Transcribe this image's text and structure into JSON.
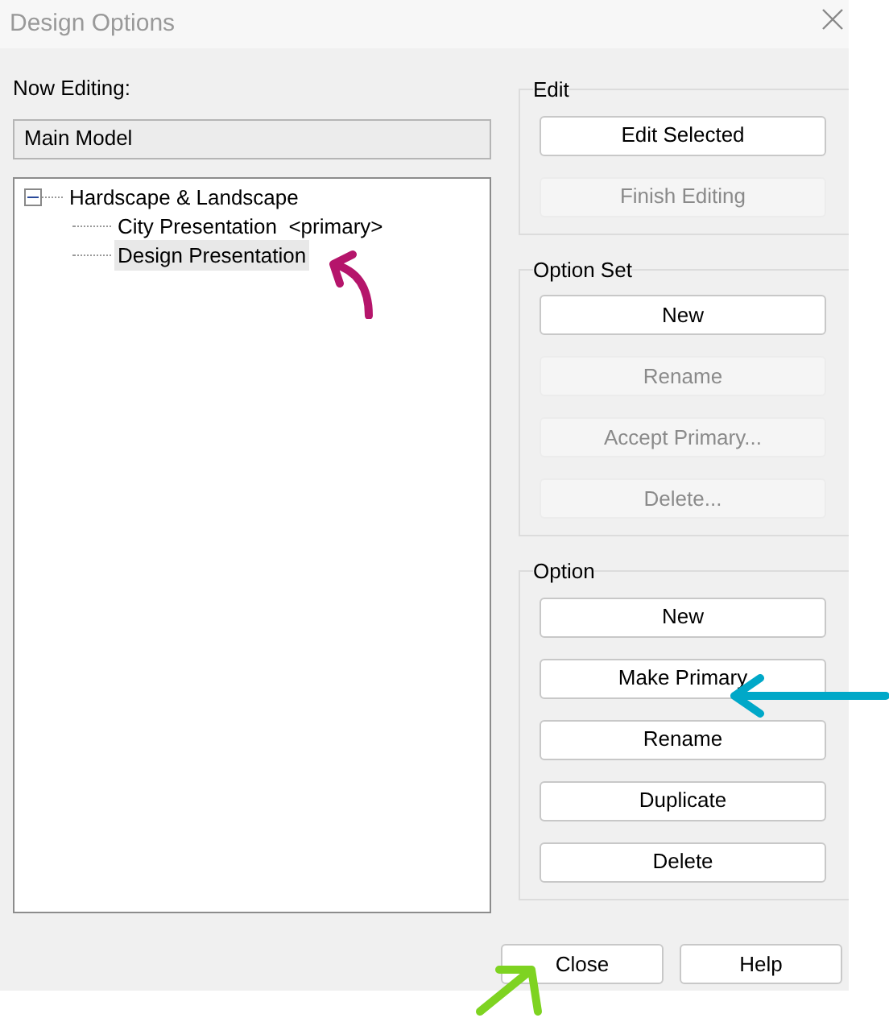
{
  "window": {
    "title": "Design Options"
  },
  "now_editing": {
    "label": "Now Editing:",
    "value": "Main Model"
  },
  "tree": [
    {
      "label": "Hardscape & Landscape",
      "expanded": true,
      "selected": false,
      "children": [
        {
          "label": "City Presentation  <primary>",
          "selected": false
        },
        {
          "label": "Design Presentation",
          "selected": true
        }
      ]
    }
  ],
  "groups": [
    {
      "title": "Edit",
      "buttons": [
        {
          "label": "Edit Selected",
          "disabled": false
        },
        {
          "label": "Finish Editing",
          "disabled": true
        }
      ]
    },
    {
      "title": "Option Set",
      "buttons": [
        {
          "label": "New",
          "disabled": false
        },
        {
          "label": "Rename",
          "disabled": true
        },
        {
          "label": "Accept Primary...",
          "disabled": true
        },
        {
          "label": "Delete...",
          "disabled": true
        }
      ]
    },
    {
      "title": "Option",
      "buttons": [
        {
          "label": "New",
          "disabled": false
        },
        {
          "label": "Make Primary",
          "disabled": false
        },
        {
          "label": "Rename",
          "disabled": false
        },
        {
          "label": "Duplicate",
          "disabled": false
        },
        {
          "label": "Delete",
          "disabled": false
        }
      ]
    }
  ],
  "footer_buttons": [
    {
      "label": "Close"
    },
    {
      "label": "Help"
    }
  ]
}
